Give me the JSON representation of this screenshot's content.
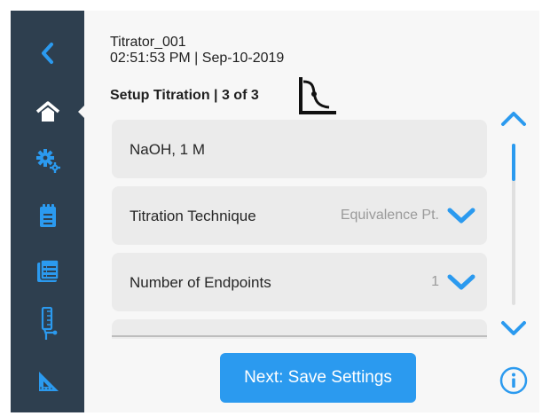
{
  "sidebar": {
    "items": [
      {
        "icon": "back-chevron-icon"
      },
      {
        "icon": "home-icon",
        "active": true
      },
      {
        "icon": "gears-icon"
      },
      {
        "icon": "clipboard-icon"
      },
      {
        "icon": "folder-list-icon"
      },
      {
        "icon": "burette-icon"
      },
      {
        "icon": "set-square-icon"
      }
    ]
  },
  "header": {
    "device_name": "Titrator_001",
    "datetime": "02:51:53 PM | Sep-10-2019",
    "step_title": "Setup Titration | 3 of 3",
    "step_icon": "titration-curve-icon"
  },
  "settings": {
    "rows": [
      {
        "label": "NaOH, 1 M"
      },
      {
        "label": "Titration Technique",
        "value": "Equivalence Pt."
      },
      {
        "label": "Number of Endpoints",
        "value": "1"
      }
    ]
  },
  "footer": {
    "next_label": "Next: Save Settings"
  },
  "colors": {
    "sidebar": "#2e3f4f",
    "accent": "#2b9aef",
    "row_background": "#ebebeb",
    "page_background": "#f7f7f7"
  }
}
